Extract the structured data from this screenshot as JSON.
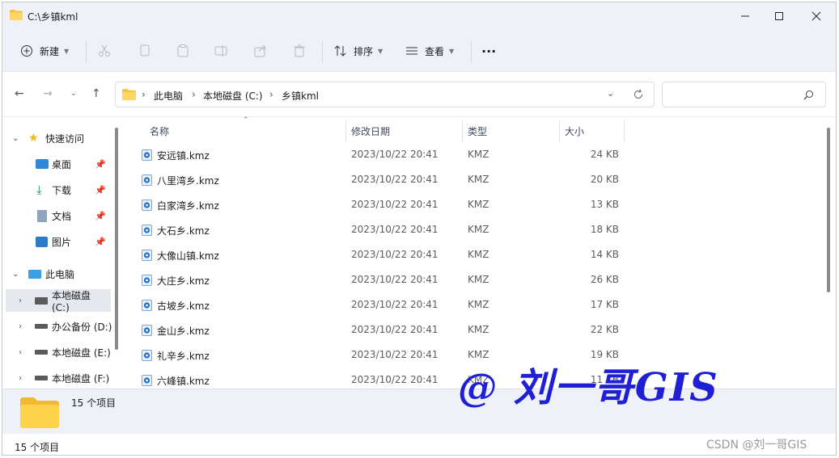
{
  "window": {
    "title": "C:\\乡镇kml"
  },
  "toolbar": {
    "new_label": "新建",
    "sort_label": "排序",
    "view_label": "查看",
    "more_label": "···"
  },
  "address": {
    "crumbs": [
      "此电脑",
      "本地磁盘 (C:)",
      "乡镇kml"
    ],
    "search_placeholder": ""
  },
  "sidebar": {
    "quick_access": "快速访问",
    "items": [
      {
        "label": "桌面",
        "icon": "desktop-icon",
        "pinned": true
      },
      {
        "label": "下载",
        "icon": "download-icon",
        "pinned": true
      },
      {
        "label": "文档",
        "icon": "document-icon",
        "pinned": true
      },
      {
        "label": "图片",
        "icon": "picture-icon",
        "pinned": true
      }
    ],
    "this_pc": "此电脑",
    "drives": [
      {
        "label": "本地磁盘 (C:)",
        "selected": true
      },
      {
        "label": "办公备份 (D:)",
        "selected": false
      },
      {
        "label": "本地磁盘 (E:)",
        "selected": false
      },
      {
        "label": "本地磁盘 (F:)",
        "selected": false
      }
    ]
  },
  "columns": {
    "name": "名称",
    "date": "修改日期",
    "type": "类型",
    "size": "大小"
  },
  "files": [
    {
      "name": "安远镇.kmz",
      "date": "2023/10/22 20:41",
      "type": "KMZ",
      "size": "24 KB"
    },
    {
      "name": "八里湾乡.kmz",
      "date": "2023/10/22 20:41",
      "type": "KMZ",
      "size": "20 KB"
    },
    {
      "name": "白家湾乡.kmz",
      "date": "2023/10/22 20:41",
      "type": "KMZ",
      "size": "13 KB"
    },
    {
      "name": "大石乡.kmz",
      "date": "2023/10/22 20:41",
      "type": "KMZ",
      "size": "18 KB"
    },
    {
      "name": "大像山镇.kmz",
      "date": "2023/10/22 20:41",
      "type": "KMZ",
      "size": "14 KB"
    },
    {
      "name": "大庄乡.kmz",
      "date": "2023/10/22 20:41",
      "type": "KMZ",
      "size": "26 KB"
    },
    {
      "name": "古坡乡.kmz",
      "date": "2023/10/22 20:41",
      "type": "KMZ",
      "size": "17 KB"
    },
    {
      "name": "金山乡.kmz",
      "date": "2023/10/22 20:41",
      "type": "KMZ",
      "size": "22 KB"
    },
    {
      "name": "礼辛乡.kmz",
      "date": "2023/10/22 20:41",
      "type": "KMZ",
      "size": "19 KB"
    },
    {
      "name": "六峰镇.kmz",
      "date": "2023/10/22 20:41",
      "type": "KMZ",
      "size": "11 KB"
    }
  ],
  "details": {
    "count_label": "15 个项目"
  },
  "status": {
    "count_label": "15 个项目"
  },
  "watermark": {
    "text": "@ 刘一哥GIS",
    "color": "#1f1fd6"
  },
  "csdn": {
    "text": "CSDN @刘一哥GIS"
  },
  "colors": {
    "chrome": "#eef2f8",
    "folder": "#f5c242",
    "accent": "#1a6fcf"
  }
}
